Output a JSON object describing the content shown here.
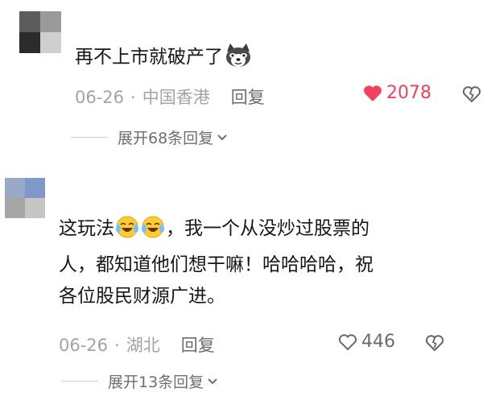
{
  "comments": [
    {
      "text_lines": [
        "再不上市就破产了"
      ],
      "emoji": "husky-face-emoji",
      "date": "06-26",
      "location": "中国香港",
      "reply_label": "回复",
      "likes": "2078",
      "liked": true,
      "expand_label": "展开68条回复"
    },
    {
      "text_lines": [
        "这玩法",
        "，我一个从没炒过股票的",
        "人，都知道他们想干嘛！哈哈哈哈，祝",
        "各位股民财源广进。"
      ],
      "emoji": "crying-laughing-emoji",
      "date": "06-26",
      "location": "湖北",
      "reply_label": "回复",
      "likes": "446",
      "liked": false,
      "expand_label": "展开13条回复"
    }
  ],
  "colors": {
    "like_red": "#f0425e",
    "meta_gray": "#a3a3a3",
    "text": "#161616"
  }
}
